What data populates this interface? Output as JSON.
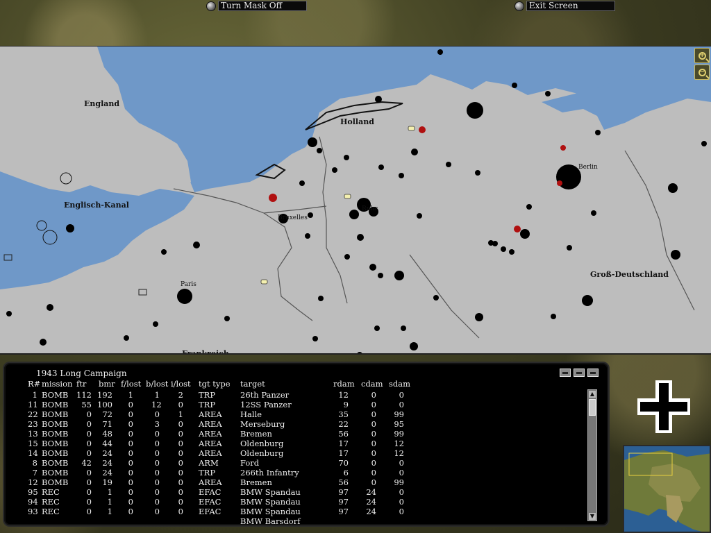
{
  "top_bar": {
    "mask_button": "Turn Mask Off",
    "exit_button": "Exit Screen"
  },
  "map": {
    "region_labels": {
      "england": "England",
      "kanal": "Englisch-Kanal",
      "holland": "Holland",
      "ruhr": "Ruhr",
      "paris": "Paris",
      "berlin": "Berlin",
      "gross": "Groß-Deutschland",
      "frankreich": "Frankreich",
      "bruxelles": "Bruxelles"
    },
    "colors": {
      "land": "#bdbdbd",
      "sea": "#6f98c8",
      "city": "#000000",
      "target": "#b01010"
    },
    "zoom_in_icon": "zoom-in-icon",
    "zoom_out_icon": "zoom-out-icon"
  },
  "panel": {
    "title": "1943 Long Campaign",
    "columns": [
      "R#",
      "mission",
      "ftr",
      "bmr",
      "f/lost",
      "b/lost",
      "i/lost",
      "tgt type",
      "target",
      "rdam",
      "cdam",
      "sdam"
    ],
    "rows": [
      {
        "r": "1",
        "mission": "BOMB",
        "ftr": "112",
        "bmr": "192",
        "flost": "1",
        "blost": "1",
        "ilost": "2",
        "type": "TRP",
        "target": "26th Panzer",
        "rdam": "12",
        "cdam": "0",
        "sdam": "0"
      },
      {
        "r": "11",
        "mission": "BOMB",
        "ftr": "55",
        "bmr": "100",
        "flost": "0",
        "blost": "12",
        "ilost": "0",
        "type": "TRP",
        "target": "12SS Panzer",
        "rdam": "9",
        "cdam": "0",
        "sdam": "0"
      },
      {
        "r": "22",
        "mission": "BOMB",
        "ftr": "0",
        "bmr": "72",
        "flost": "0",
        "blost": "0",
        "ilost": "1",
        "type": "AREA",
        "target": "Halle",
        "rdam": "35",
        "cdam": "0",
        "sdam": "99"
      },
      {
        "r": "23",
        "mission": "BOMB",
        "ftr": "0",
        "bmr": "71",
        "flost": "0",
        "blost": "3",
        "ilost": "0",
        "type": "AREA",
        "target": "Merseburg",
        "rdam": "22",
        "cdam": "0",
        "sdam": "95"
      },
      {
        "r": "13",
        "mission": "BOMB",
        "ftr": "0",
        "bmr": "48",
        "flost": "0",
        "blost": "0",
        "ilost": "0",
        "type": "AREA",
        "target": "Bremen",
        "rdam": "56",
        "cdam": "0",
        "sdam": "99"
      },
      {
        "r": "15",
        "mission": "BOMB",
        "ftr": "0",
        "bmr": "44",
        "flost": "0",
        "blost": "0",
        "ilost": "0",
        "type": "AREA",
        "target": "Oldenburg",
        "rdam": "17",
        "cdam": "0",
        "sdam": "12"
      },
      {
        "r": "14",
        "mission": "BOMB",
        "ftr": "0",
        "bmr": "24",
        "flost": "0",
        "blost": "0",
        "ilost": "0",
        "type": "AREA",
        "target": "Oldenburg",
        "rdam": "17",
        "cdam": "0",
        "sdam": "12"
      },
      {
        "r": "8",
        "mission": "BOMB",
        "ftr": "42",
        "bmr": "24",
        "flost": "0",
        "blost": "0",
        "ilost": "0",
        "type": "ARM",
        "target": "Ford",
        "rdam": "70",
        "cdam": "0",
        "sdam": "0"
      },
      {
        "r": "7",
        "mission": "BOMB",
        "ftr": "0",
        "bmr": "24",
        "flost": "0",
        "blost": "0",
        "ilost": "0",
        "type": "TRP",
        "target": "266th Infantry",
        "rdam": "6",
        "cdam": "0",
        "sdam": "0"
      },
      {
        "r": "12",
        "mission": "BOMB",
        "ftr": "0",
        "bmr": "19",
        "flost": "0",
        "blost": "0",
        "ilost": "0",
        "type": "AREA",
        "target": "Bremen",
        "rdam": "56",
        "cdam": "0",
        "sdam": "99"
      },
      {
        "r": "95",
        "mission": "REC",
        "ftr": "0",
        "bmr": "1",
        "flost": "0",
        "blost": "0",
        "ilost": "0",
        "type": "EFAC",
        "target": "BMW Spandau",
        "rdam": "97",
        "cdam": "24",
        "sdam": "0"
      },
      {
        "r": "94",
        "mission": "REC",
        "ftr": "0",
        "bmr": "1",
        "flost": "0",
        "blost": "0",
        "ilost": "0",
        "type": "EFAC",
        "target": "BMW Spandau",
        "rdam": "97",
        "cdam": "24",
        "sdam": "0"
      },
      {
        "r": "93",
        "mission": "REC",
        "ftr": "0",
        "bmr": "1",
        "flost": "0",
        "blost": "0",
        "ilost": "0",
        "type": "EFAC",
        "target": "BMW Spandau",
        "rdam": "97",
        "cdam": "24",
        "sdam": "0"
      },
      {
        "r": "",
        "mission": "",
        "ftr": "",
        "bmr": "",
        "flost": "",
        "blost": "",
        "ilost": "",
        "type": "",
        "target": "BMW Barsdorf",
        "rdam": "",
        "cdam": "",
        "sdam": ""
      }
    ]
  },
  "side": {
    "cross_icon": "balkenkreuz-icon",
    "minimap_icon": "minimap"
  }
}
